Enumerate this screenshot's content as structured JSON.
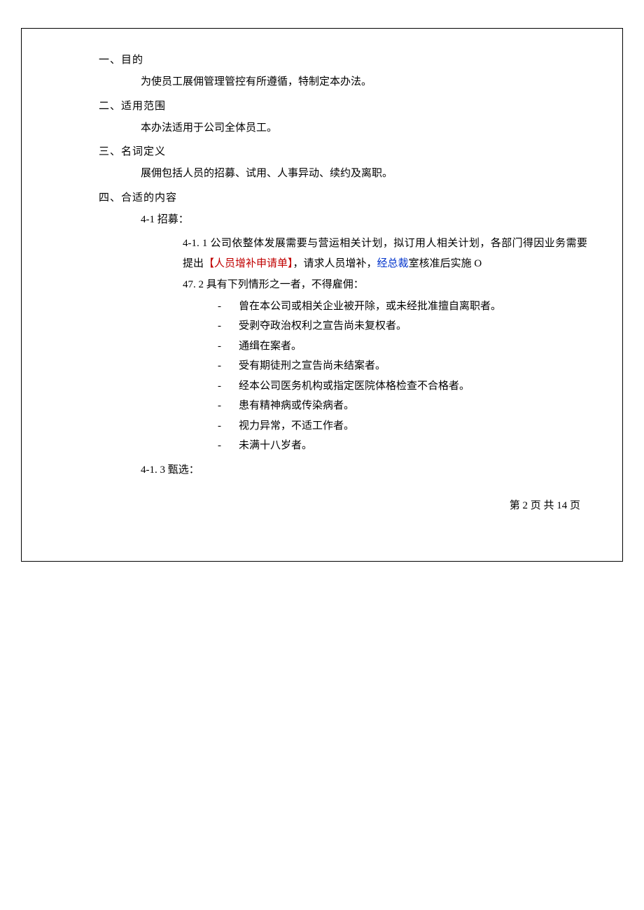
{
  "section1": {
    "heading": "一、目的",
    "body": "为使员工展佣管理管控有所遵循，特制定本办法。"
  },
  "section2": {
    "heading": "二、适用范围",
    "body": "本办法适用于公司全体员工。"
  },
  "section3": {
    "heading": "三、名词定义",
    "body": "展佣包括人员的招募、试用、人事异动、续约及离职。"
  },
  "section4": {
    "heading": "四、合适的内容",
    "sub41_heading": "4-1 招募：",
    "sub411_pre": "4-1. 1 公司依整体发展需要与营运相关计划，拟订用人相关计划，各部门得因业务需要提出",
    "sub411_red": "【人员增补申请单】",
    "sub411_mid": "，请求人员增补，",
    "sub411_blue": "经总裁",
    "sub411_post": "室核准后实施 O",
    "sub472": "47. 2 具有下列情形之一者，不得雇佣：",
    "bullets": [
      "曾在本公司或相关企业被开除，或未经批准擅自离职者。",
      "受剥夺政治权利之宣告尚未复权者。",
      "通缉在案者。",
      "受有期徒刑之宣告尚未结案者。",
      "经本公司医务机构或指定医院体格检查不合格者。",
      "患有精神病或传染病者。",
      "视力异常，不适工作者。",
      "未满十八岁者。"
    ],
    "sub413": "4-1. 3 甄选："
  },
  "dash": "-",
  "page_footer": "第 2 页 共 14 页"
}
